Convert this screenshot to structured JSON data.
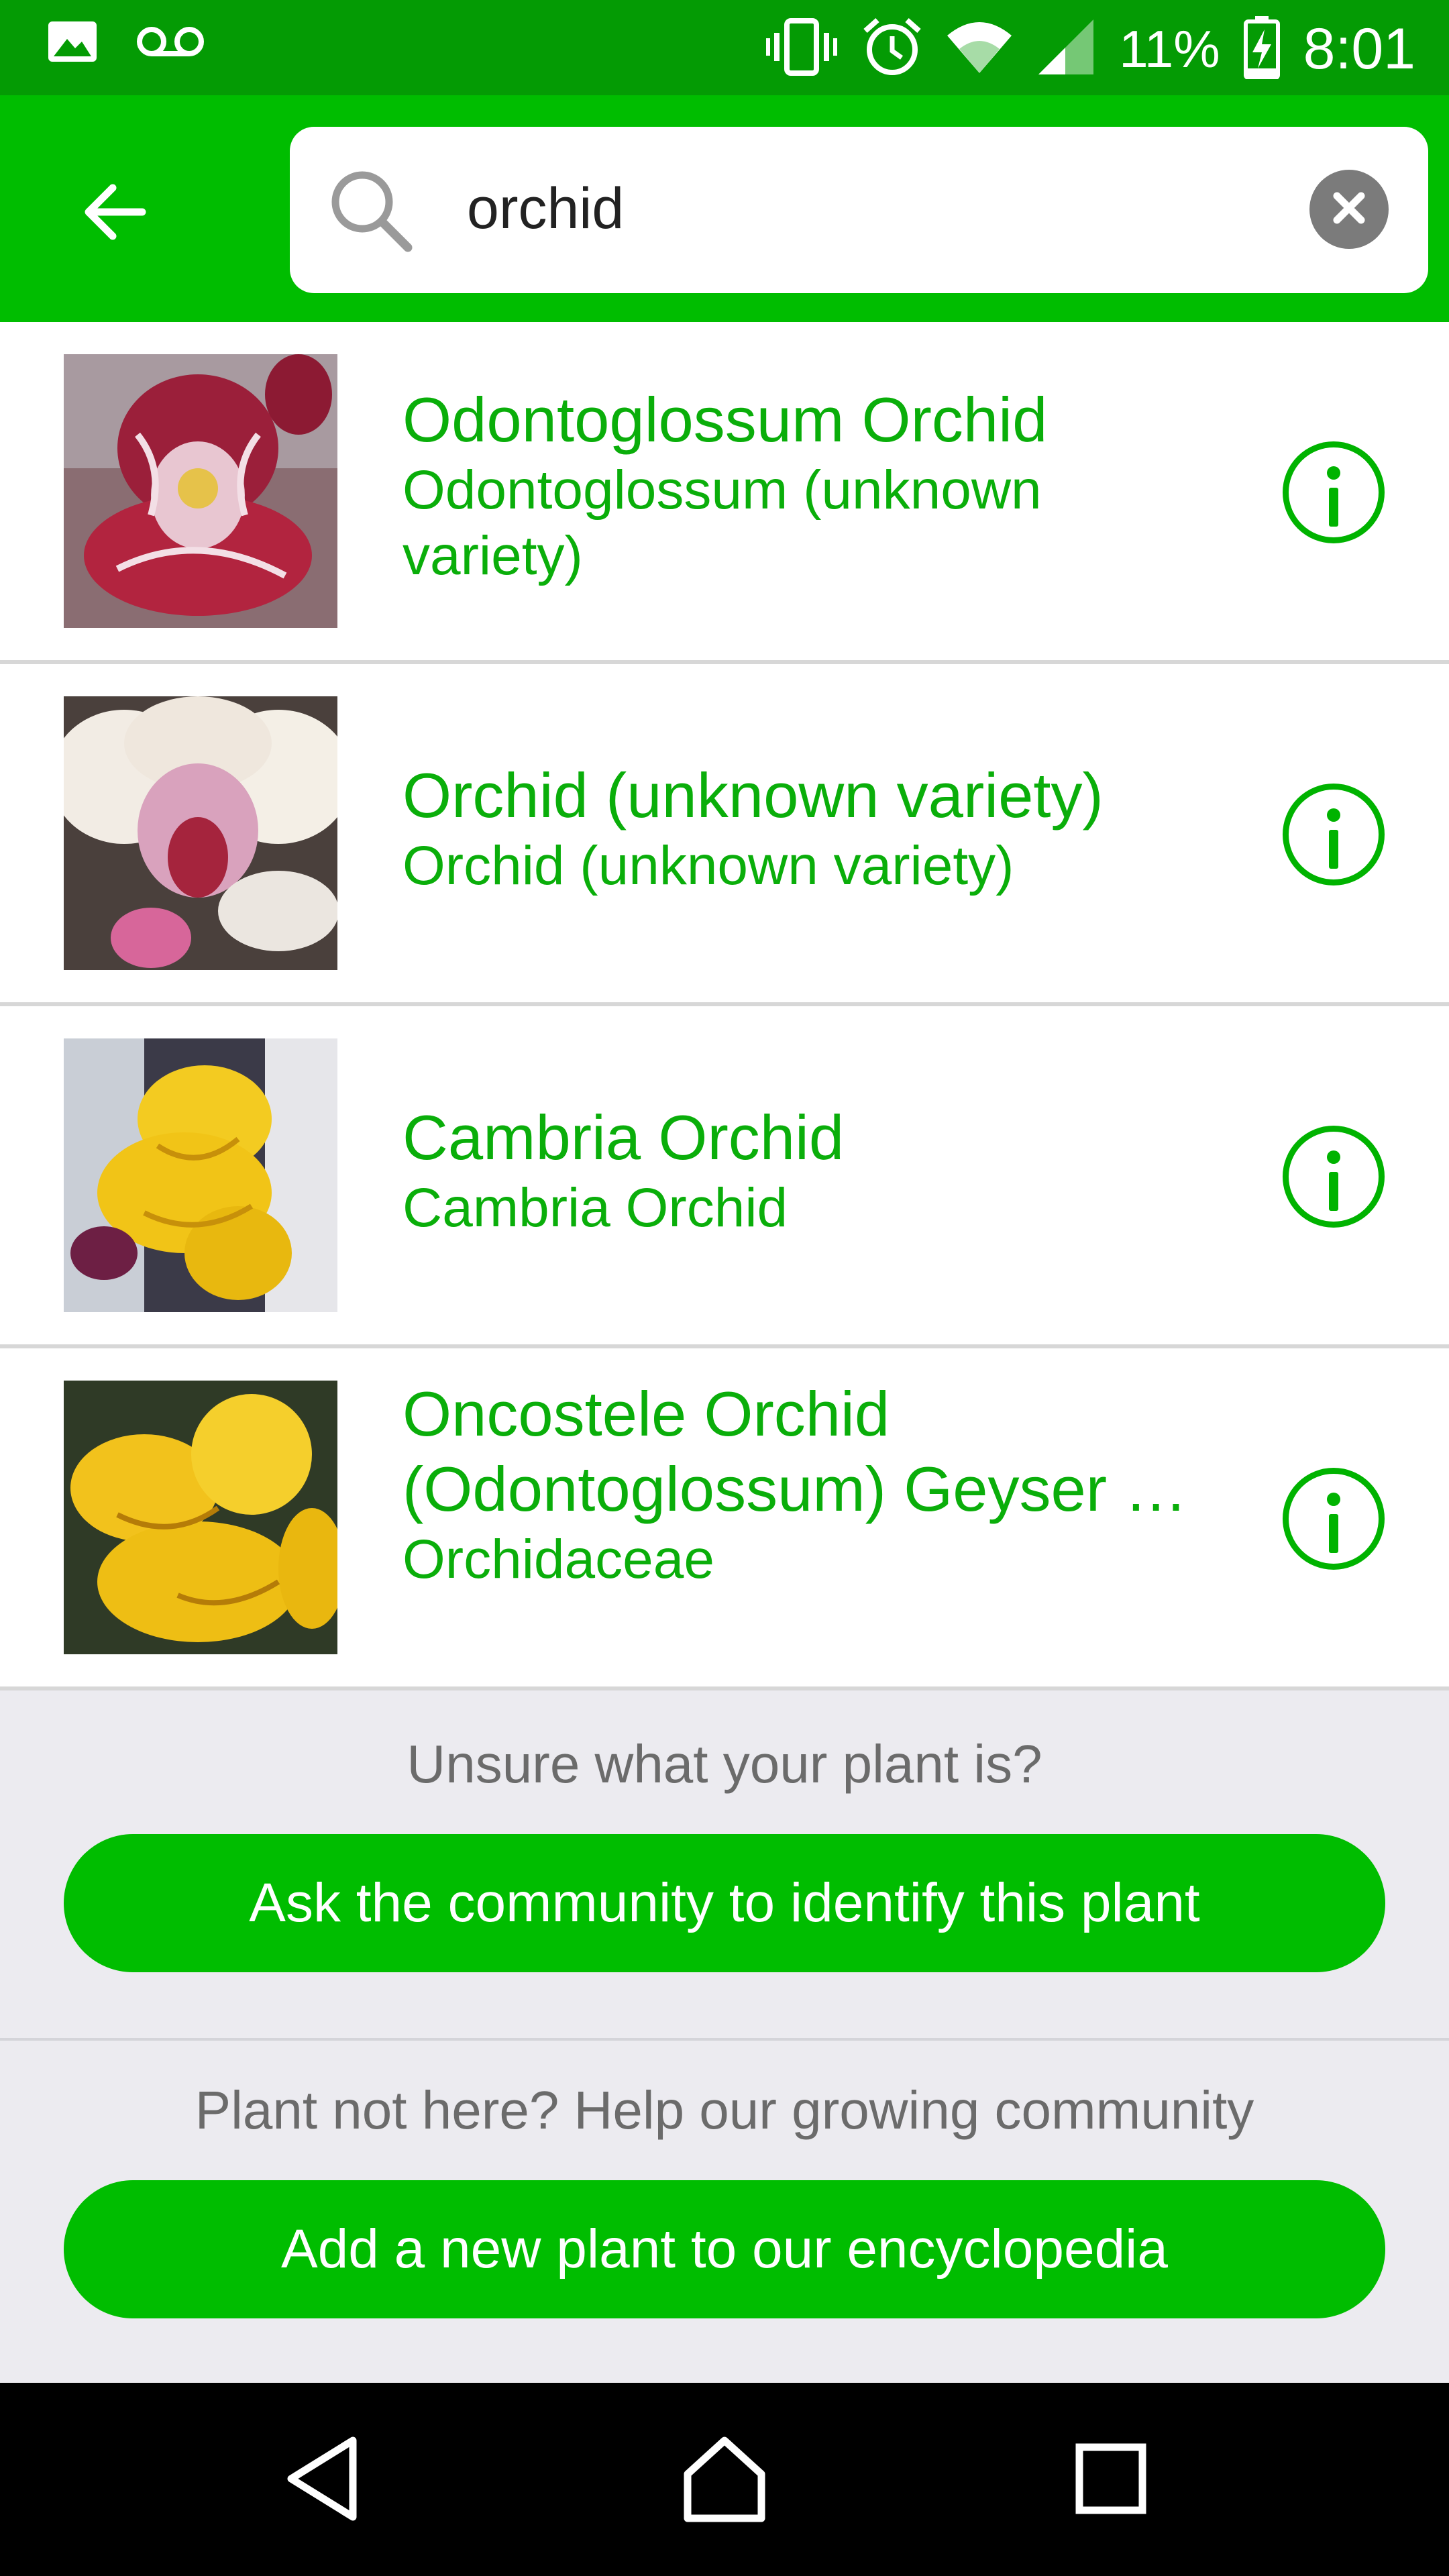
{
  "status_bar": {
    "battery_percent": "11%",
    "time": "8:01",
    "icons": [
      "image-icon",
      "voicemail-icon",
      "vibrate-icon",
      "alarm-icon",
      "wifi-icon",
      "signal-icon",
      "battery-charging-icon"
    ]
  },
  "search": {
    "query": "orchid",
    "icons": [
      "back-arrow-icon",
      "search-icon",
      "clear-icon"
    ]
  },
  "results": [
    {
      "title": "Odontoglossum Orchid",
      "subtitle": "Odontoglossum (unknown variety)",
      "image": "red-orchid-photo"
    },
    {
      "title": "Orchid (unknown variety)",
      "subtitle": "Orchid (unknown variety)",
      "image": "white-pink-orchid-photo"
    },
    {
      "title": "Cambria Orchid",
      "subtitle": "Cambria Orchid",
      "image": "yellow-orchid-photo"
    },
    {
      "title": "Oncostele Orchid (Odontoglossum) Geyser …",
      "subtitle": "Orchidaceae",
      "image": "yellow-orchid-closeup-photo"
    }
  ],
  "help": {
    "unsure_text": "Unsure what your plant is?",
    "ask_button": "Ask the community to identify this plant",
    "not_here_text": "Plant not here? Help our growing community",
    "add_button": "Add a new plant to our encyclopedia"
  },
  "colors": {
    "status_bar": "#049b04",
    "app_bar": "#00bd00",
    "accent_text": "#0aae0a",
    "footer_bg": "#ecebf0"
  },
  "nav": {
    "icons": [
      "back-triangle-icon",
      "home-icon",
      "recents-icon"
    ]
  }
}
